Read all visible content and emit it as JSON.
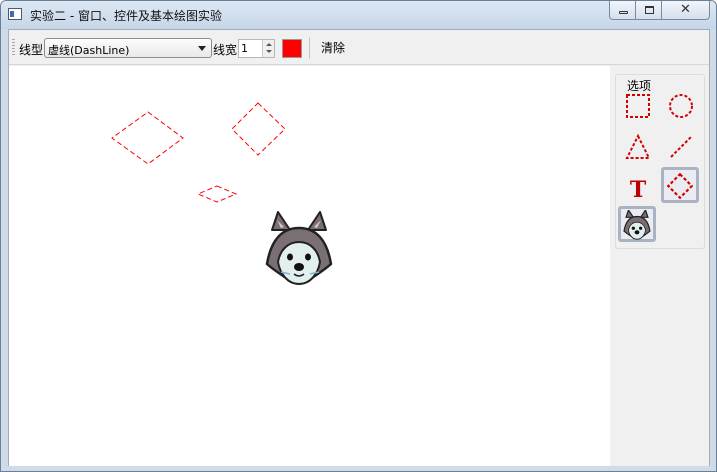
{
  "window": {
    "title": "实验二 - 窗口、控件及基本绘图实验"
  },
  "window_controls": {
    "close_glyph": "✕"
  },
  "toolbar": {
    "line_style_label": "线型",
    "line_style_value": "虚线(DashLine)",
    "line_width_label": "线宽",
    "line_width_value": "1",
    "color": "#ff0000",
    "clear_label": "清除"
  },
  "tools_panel": {
    "group_title": "选项",
    "tools": [
      {
        "name": "rectangle-tool",
        "icon": "dashed-rectangle-icon",
        "selected": false
      },
      {
        "name": "ellipse-tool",
        "icon": "dashed-circle-icon",
        "selected": false
      },
      {
        "name": "triangle-tool",
        "icon": "dashed-triangle-icon",
        "selected": false
      },
      {
        "name": "line-tool",
        "icon": "dashed-line-icon",
        "selected": false
      },
      {
        "name": "text-tool",
        "icon": "text-T-icon",
        "label": "T",
        "selected": false
      },
      {
        "name": "diamond-tool",
        "icon": "dashed-diamond-icon",
        "selected": true
      },
      {
        "name": "image-tool",
        "icon": "husky-image-icon",
        "selected": false
      }
    ]
  },
  "canvas": {
    "shapes": [
      "diamond",
      "diamond",
      "diamond",
      "husky-image"
    ],
    "stroke_color": "#ff0000"
  }
}
